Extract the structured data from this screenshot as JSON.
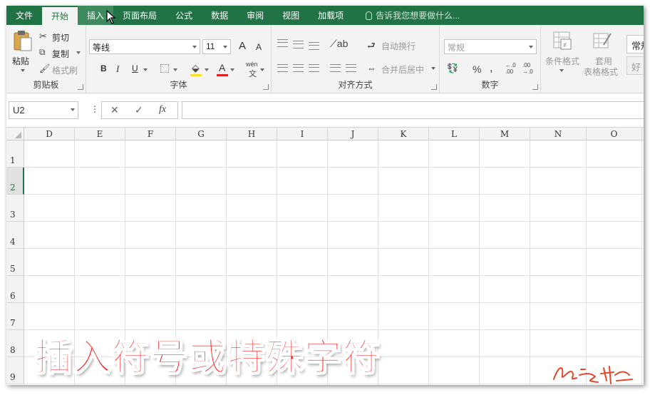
{
  "tabs": [
    {
      "label": "文件",
      "state": "normal"
    },
    {
      "label": "开始",
      "state": "active"
    },
    {
      "label": "插入",
      "state": "hover"
    },
    {
      "label": "页面布局",
      "state": "normal"
    },
    {
      "label": "公式",
      "state": "normal"
    },
    {
      "label": "数据",
      "state": "normal"
    },
    {
      "label": "审阅",
      "state": "normal"
    },
    {
      "label": "视图",
      "state": "normal"
    },
    {
      "label": "加载项",
      "state": "normal"
    }
  ],
  "tell_me": {
    "placeholder": "告诉我您想要做什么...",
    "icon": "lightbulb-icon"
  },
  "ribbon": {
    "clipboard": {
      "label": "剪贴板",
      "paste": "粘贴",
      "cut": "剪切",
      "copy": "复制",
      "format_painter": "格式刷"
    },
    "font": {
      "label": "字体",
      "font_name": "等线",
      "font_size": "11",
      "grow": "A",
      "shrink": "A",
      "bold": "B",
      "italic": "I",
      "underline": "U",
      "font_color_letter": "A",
      "phonetic": "wén",
      "phonetic_char": "文"
    },
    "alignment": {
      "label": "对齐方式",
      "wrap_text": "自动换行",
      "merge_center": "合并后居中"
    },
    "number": {
      "label": "数字",
      "format": "常规",
      "percent": "%",
      "comma": ",",
      "inc_decimal": "←.0 .00",
      "dec_decimal": ".00 →.0"
    },
    "styles": {
      "conditional": "条件格式",
      "table_format_1": "套用",
      "table_format_2": "表格格式",
      "cell_style_normal": "常规",
      "cell_style_good": "好"
    }
  },
  "formula_bar": {
    "name_box": "U2",
    "cancel": "✕",
    "enter": "✓",
    "fx": "fx",
    "content": ""
  },
  "columns": [
    "D",
    "E",
    "F",
    "G",
    "H",
    "I",
    "J",
    "K",
    "L",
    "M",
    "N",
    "O"
  ],
  "rows": [
    "1",
    "2",
    "3",
    "4",
    "5",
    "6",
    "7",
    "8",
    "9"
  ],
  "selected_row": "2",
  "overlay_caption": "插入符号或特殊字符",
  "colors": {
    "accent": "#217346",
    "caption": "#ff1a1a",
    "signature": "#e04a2a"
  }
}
